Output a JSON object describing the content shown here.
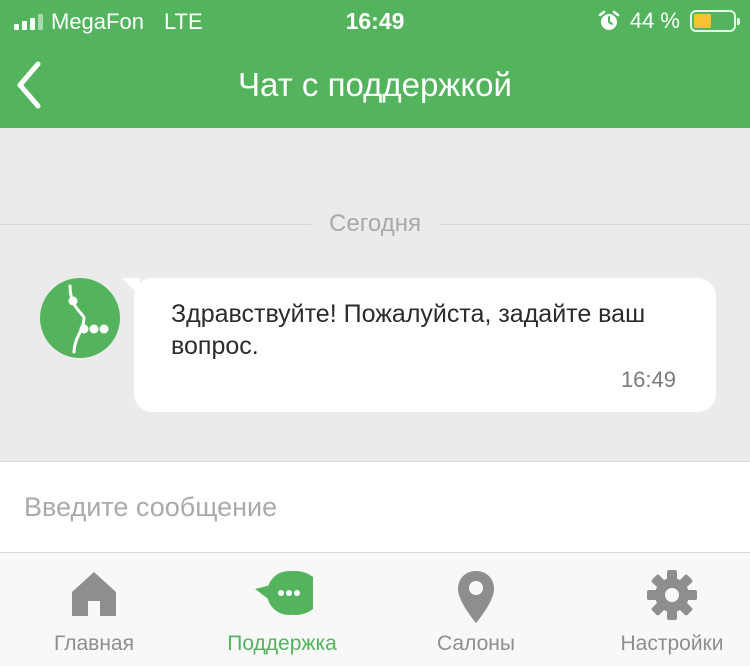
{
  "status_bar": {
    "carrier": "MegaFon",
    "network": "LTE",
    "time": "16:49",
    "battery_text": "44 %",
    "battery_level": 0.44,
    "battery_color": "#f4c430"
  },
  "header": {
    "title": "Чат с поддержкой",
    "back_icon": "chevron-left-icon",
    "background_color": "#53b45d"
  },
  "chat": {
    "date_label": "Сегодня",
    "messages": [
      {
        "sender_avatar": "megafon-logo-icon",
        "text": "Здравствуйте! Пожалуйста, задайте ваш вопрос.",
        "time": "16:49"
      }
    ]
  },
  "composer": {
    "placeholder": "Введите сообщение"
  },
  "tab_bar": {
    "active_color": "#53b45d",
    "inactive_color": "#8e8e8e",
    "tabs": [
      {
        "label": "Главная",
        "icon": "home-icon",
        "active": false
      },
      {
        "label": "Поддержка",
        "icon": "chat-bubble-icon",
        "active": true
      },
      {
        "label": "Салоны",
        "icon": "map-pin-icon",
        "active": false
      },
      {
        "label": "Настройки",
        "icon": "gear-icon",
        "active": false
      }
    ]
  }
}
